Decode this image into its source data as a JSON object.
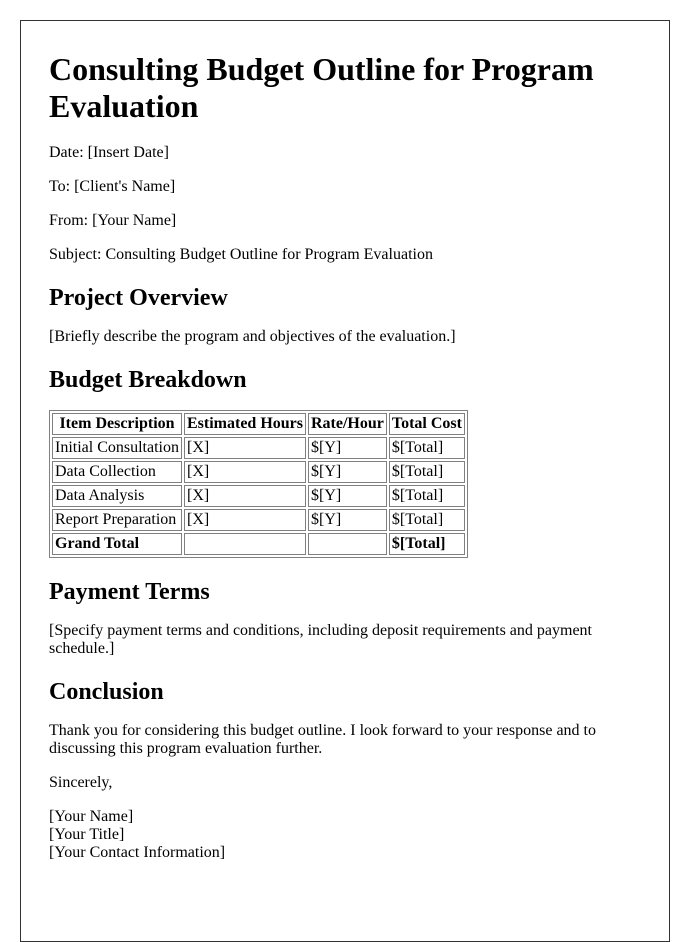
{
  "title": "Consulting Budget Outline for Program Evaluation",
  "meta": {
    "date": "Date: [Insert Date]",
    "to": "To: [Client's Name]",
    "from": "From: [Your Name]",
    "subject": "Subject: Consulting Budget Outline for Program Evaluation"
  },
  "sections": {
    "overview": {
      "heading": "Project Overview",
      "body": "[Briefly describe the program and objectives of the evaluation.]"
    },
    "budget": {
      "heading": "Budget Breakdown",
      "table": {
        "headers": [
          "Item Description",
          "Estimated Hours",
          "Rate/Hour",
          "Total Cost"
        ],
        "rows": [
          [
            "Initial Consultation",
            "[X]",
            "$[Y]",
            "$[Total]"
          ],
          [
            "Data Collection",
            "[X]",
            "$[Y]",
            "$[Total]"
          ],
          [
            "Data Analysis",
            "[X]",
            "$[Y]",
            "$[Total]"
          ],
          [
            "Report Preparation",
            "[X]",
            "$[Y]",
            "$[Total]"
          ]
        ],
        "total_row": [
          "Grand Total",
          "",
          "",
          "$[Total]"
        ]
      }
    },
    "payment": {
      "heading": "Payment Terms",
      "body": "[Specify payment terms and conditions, including deposit requirements and payment schedule.]"
    },
    "conclusion": {
      "heading": "Conclusion",
      "body": "Thank you for considering this budget outline. I look forward to your response and to discussing this program evaluation further."
    }
  },
  "closing": "Sincerely,",
  "signature": {
    "name": "[Your Name]",
    "title": "[Your Title]",
    "contact": "[Your Contact Information]"
  }
}
